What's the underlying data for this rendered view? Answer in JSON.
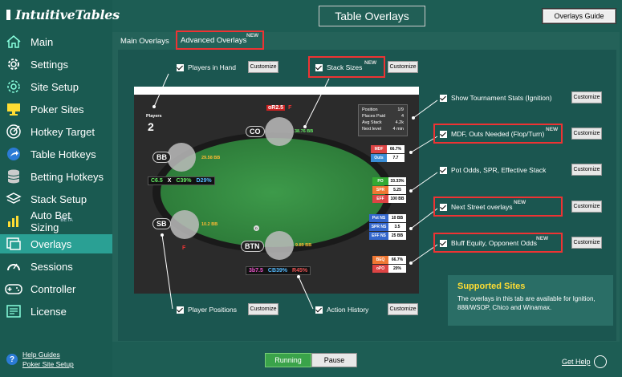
{
  "app": {
    "logo_text": "IntuitiveTables",
    "page_title": "Table Overlays",
    "guide_button": "Overlays Guide"
  },
  "sidebar": {
    "items": [
      {
        "label": "Main",
        "icon": "home-icon"
      },
      {
        "label": "Settings",
        "icon": "gear-icon"
      },
      {
        "label": "Site Setup",
        "icon": "gear-outline-icon"
      },
      {
        "label": "Poker Sites",
        "icon": "monitor-icon"
      },
      {
        "label": "Hotkey Target",
        "icon": "target-icon"
      },
      {
        "label": "Table Hotkeys",
        "icon": "share-arrow-icon"
      },
      {
        "label": "Betting Hotkeys",
        "icon": "database-icon"
      },
      {
        "label": "Stack Setup",
        "icon": "layers-icon"
      },
      {
        "label": "Auto Bet Sizing",
        "icon": "bar-chart-icon",
        "badge": "BETA"
      },
      {
        "label": "Overlays",
        "icon": "overlay-window-icon",
        "active": true
      },
      {
        "label": "Sessions",
        "icon": "gauge-icon"
      },
      {
        "label": "Controller",
        "icon": "gamepad-icon"
      },
      {
        "label": "License",
        "icon": "license-card-icon"
      }
    ],
    "help_guides": "Help Guides",
    "poker_site_setup": "Poker Site Setup"
  },
  "tabs": {
    "main": "Main Overlays",
    "advanced": "Advanced Overlays",
    "new_badge": "NEW"
  },
  "options": {
    "players_in_hand": "Players in Hand",
    "stack_sizes": "Stack Sizes",
    "tournament_stats": "Show Tournament Stats (Ignition)",
    "mdf_outs": "MDF, Outs Needed (Flop/Turn)",
    "pot_odds": "Pot Odds, SPR, Effective Stack",
    "next_street": "Next Street overlays",
    "bluff_equity": "Bluff Equity, Opponent Odds",
    "player_positions": "Player Positions",
    "action_history": "Action History",
    "customize": "Customize",
    "new": "NEW"
  },
  "table": {
    "players_label": "Players",
    "players_count": "2",
    "co": "CO",
    "bb": "BB",
    "sb": "SB",
    "btn": "BTN",
    "dealer": "D",
    "action_co": "oR2.5",
    "action_co_f": "F",
    "stack_co": "38.76 BB",
    "stack_bb": "29.58 BB",
    "stack_sb": "10.2 BB",
    "stack_btn": "9.89 BB",
    "sb_f": "F",
    "bb_stats": [
      "C6.5",
      "X",
      "C39%",
      "D29%"
    ],
    "btn_stats": [
      "3b7.5",
      "CB39%",
      "R45%"
    ],
    "info": [
      {
        "k": "Position",
        "v": "1/9"
      },
      {
        "k": "Places Paid",
        "v": "4"
      },
      {
        "k": "Avg Stack",
        "v": "4.2k"
      },
      {
        "k": "Next level",
        "v": "4 min"
      }
    ],
    "mdf_badges": [
      {
        "k": "MDF",
        "v": "66.7%"
      },
      {
        "k": "Outs",
        "v": "7.7"
      }
    ],
    "pot_badges": [
      {
        "k": "PO",
        "v": "33.33%"
      },
      {
        "k": "SPR",
        "v": "5.25"
      },
      {
        "k": "EFF",
        "v": "100 BB"
      }
    ],
    "next_badges": [
      {
        "k": "Pot NS",
        "v": "10 BB"
      },
      {
        "k": "SPR NS",
        "v": "3.5"
      },
      {
        "k": "EFF NS",
        "v": "25 BB"
      }
    ],
    "bluff_badges": [
      {
        "k": "BEQ",
        "v": "66.7%"
      },
      {
        "k": "oPO",
        "v": "20%"
      }
    ]
  },
  "supported": {
    "title": "Supported Sites",
    "text": "The overlays in this tab are available for Ignition, 888/WSOP, Chico and Winamax."
  },
  "controls": {
    "running": "Running",
    "pause": "Pause",
    "get_help": "Get Help"
  }
}
